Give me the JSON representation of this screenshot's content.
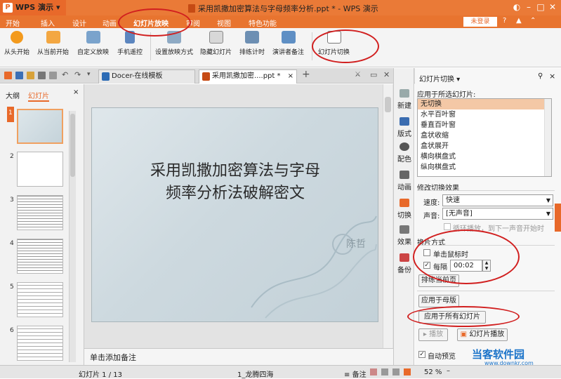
{
  "app": {
    "name": "WPS 演示",
    "logo": "P",
    "window_title": "采用凯撒加密算法与字母频率分析.ppt * - WPS 演示",
    "login": "未登录"
  },
  "menu": [
    "开始",
    "插入",
    "设计",
    "动画",
    "幻灯片放映",
    "审阅",
    "视图",
    "特色功能"
  ],
  "ribbon": {
    "buttons": [
      "从头开始",
      "从当前开始",
      "自定义放映",
      "手机遥控",
      "设置放映方式",
      "隐藏幻灯片",
      "排练计时",
      "演讲者备注",
      "幻灯片切换"
    ]
  },
  "tabs": [
    "Docer-在线模板",
    "采用凯撒加密....ppt *"
  ],
  "left_panel": {
    "tabs": [
      "大纲",
      "幻灯片"
    ],
    "slide_numbers": [
      "1",
      "2",
      "3",
      "4",
      "5",
      "6"
    ]
  },
  "slide": {
    "title_line1": "采用凯撒加密算法与字母",
    "title_line2": "频率分析法破解密文",
    "author": "陈哲"
  },
  "notes_placeholder": "单击添加备注",
  "side_icons": [
    "新建",
    "版式",
    "配色",
    "动画",
    "切换",
    "效果",
    "备份"
  ],
  "pane": {
    "title": "幻灯片切换 ▾",
    "apply_selected_label": "应用于所选幻灯片:",
    "transitions": [
      "无切换",
      "水平百叶窗",
      "垂直百叶窗",
      "盒状收缩",
      "盒状展开",
      "横向棋盘式",
      "纵向棋盘式"
    ],
    "modify_label": "修改切换效果",
    "speed_label": "速度:",
    "speed_value": "快速",
    "sound_label": "声音:",
    "sound_value": "[无声音]",
    "loop_label": "循环播放，到下一声音开始时",
    "advance_label": "换片方式",
    "on_click_label": "单击鼠标时",
    "every_label": "每隔",
    "every_value": "00:02",
    "rehearse_button": "排练当前页",
    "apply_master_button": "应用于母版",
    "apply_all_button": "应用于所有幻灯片",
    "play_button": "播放",
    "slideshow_button": "幻灯片播放",
    "autopreview_label": "自动预览"
  },
  "status": {
    "slide_count": "幻灯片 1 / 13",
    "theme": "1_龙腾四海",
    "notes": "备注",
    "zoom": "52 %"
  },
  "watermark": {
    "name": "当客软件园",
    "url": "www.downkr.com"
  }
}
